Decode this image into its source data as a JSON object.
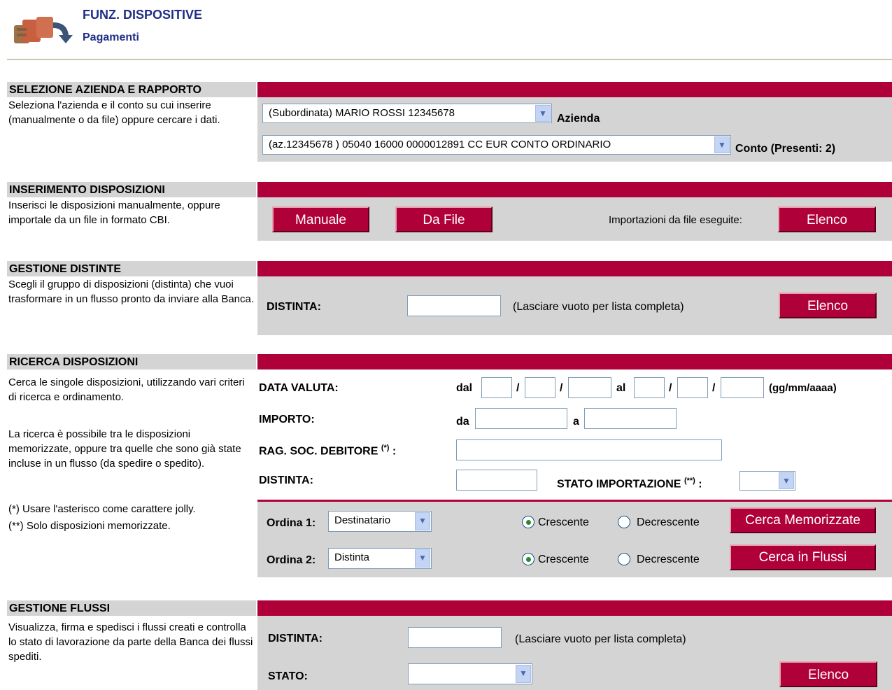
{
  "header": {
    "title": "FUNZ. DISPOSITIVE",
    "subtitle": "Pagamenti",
    "icon": "payments-icon"
  },
  "sections": {
    "azienda": {
      "title": "SELEZIONE AZIENDA E RAPPORTO",
      "description": "Seleziona l'azienda e il conto su cui inserire (manualmente o da file) oppure cercare i dati.",
      "azienda_select": "(Subordinata)  MARIO ROSSI    12345678",
      "azienda_label": "Azienda",
      "conto_select": "(az.12345678 ) 05040 16000 0000012891     CC EUR CONTO ORDINARIO",
      "conto_label": "Conto (Presenti: 2)"
    },
    "inserimento": {
      "title": "INSERIMENTO DISPOSIZIONI",
      "description": "Inserisci le disposizioni manualmente, oppure importale da un file in formato CBI.",
      "manuale_btn": "Manuale",
      "da_file_btn": "Da File",
      "import_label": "Importazioni da file eseguite:",
      "elenco_btn": "Elenco"
    },
    "distinte": {
      "title": "GESTIONE DISTINTE",
      "description": "Scegli il gruppo di disposizioni (distinta) che vuoi trasformare in un flusso pronto da inviare alla Banca.",
      "distinta_label": "DISTINTA:",
      "hint": "(Lasciare vuoto per lista completa)",
      "elenco_btn": "Elenco"
    },
    "ricerca": {
      "title": "RICERCA DISPOSIZIONI",
      "description1": "Cerca le singole disposizioni, utilizzando vari criteri di ricerca e ordinamento.",
      "description2": "La ricerca è possibile tra le disposizioni memorizzate, oppure tra quelle che sono già state incluse in un flusso (da spedire o spedito).",
      "note1": "(*) Usare l'asterisco come carattere jolly.",
      "note2": "(**) Solo disposizioni memorizzate.",
      "data_valuta_label": "DATA VALUTA:",
      "dal": "dal",
      "al": "al",
      "slash": "/",
      "date_format": "(gg/mm/aaaa)",
      "importo_label": "IMPORTO:",
      "da": "da",
      "a": "a",
      "rag_soc_label": "RAG. SOC. DEBITORE",
      "rag_soc_sup": "(*)",
      "colon": ":",
      "distinta_label": "DISTINTA:",
      "stato_label": "STATO IMPORTAZIONE",
      "stato_sup": "(**)",
      "ordina1_label": "Ordina 1:",
      "ordina1_value": "Destinatario",
      "ordina2_label": "Ordina 2:",
      "ordina2_value": "Distinta",
      "crescente": "Crescente",
      "decrescente": "Decrescente",
      "cerca_memorizzate_btn": "Cerca Memorizzate",
      "cerca_flussi_btn": "Cerca in Flussi"
    },
    "flussi": {
      "title": "GESTIONE FLUSSI",
      "description": "Visualizza, firma e spedisci i flussi creati e controlla lo stato di lavorazione da parte della Banca dei flussi spediti.",
      "distinta_label": "DISTINTA:",
      "hint": "(Lasciare vuoto per lista completa)",
      "stato_label": "STATO:",
      "elenco_btn": "Elenco"
    }
  },
  "colors": {
    "accent": "#b0003a",
    "panel": "#d4d4d4",
    "header_text": "#1f2f86"
  }
}
